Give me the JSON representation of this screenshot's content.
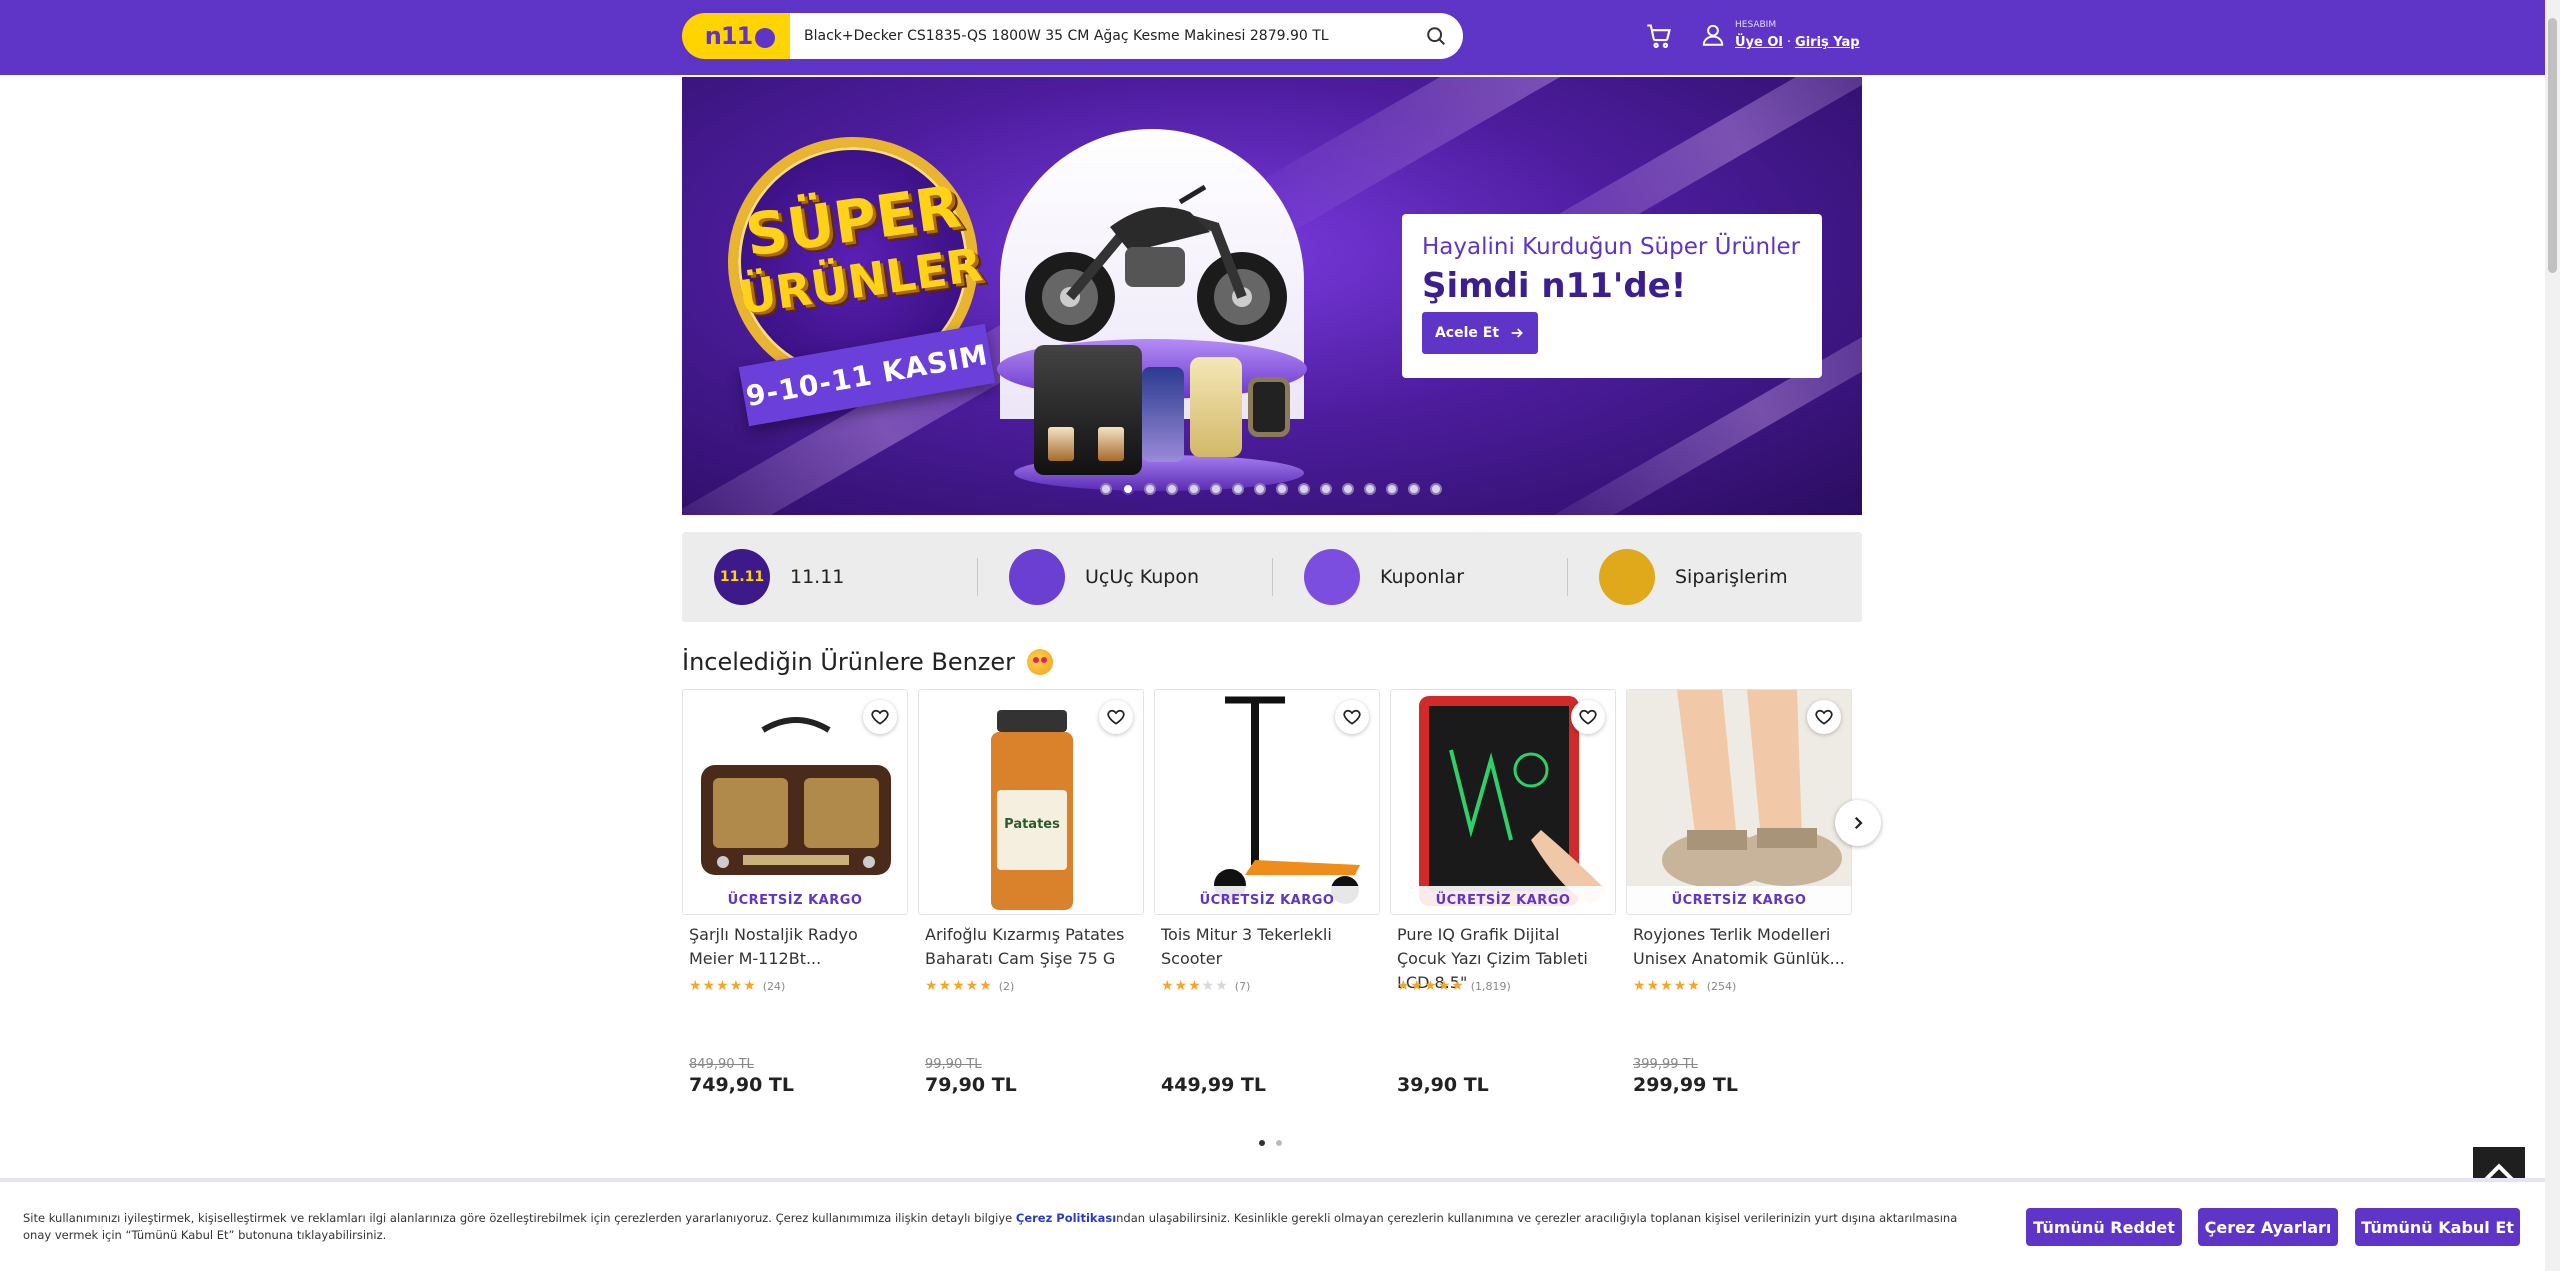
{
  "header": {
    "logo_text": "n11",
    "search_value": "Black+Decker CS1835-QS 1800W 35 CM Ağaç Kesme Makinesi 2879.90 TL",
    "account_label": "HESABIM",
    "signup": "Üye Ol",
    "login": "Giriş Yap",
    "separator": "·",
    "brand_color": "#5f35c8",
    "logo_color": "#ffd400"
  },
  "banner": {
    "badge_line1": "SÜPER",
    "badge_line2": "ÜRÜNLER",
    "date": "9-10-11 KASIM",
    "subtitle": "Hayalini Kurduğun Süper Ürünler",
    "headline": "Şimdi n11'de!",
    "cta": "Acele Et",
    "slide_count": 16,
    "active_slide": 2
  },
  "quick_links": [
    {
      "label": "11.11",
      "icon": "eleven-eleven-icon",
      "badge": "11.11",
      "color": "#3c1a8a"
    },
    {
      "label": "UçUç Kupon",
      "icon": "flying-coupon-icon",
      "badge": "",
      "color": "#6a3fd1"
    },
    {
      "label": "Kuponlar",
      "icon": "coupon-icon",
      "badge": "",
      "color": "#7b4ee0"
    },
    {
      "label": "Siparişlerim",
      "icon": "orders-icon",
      "badge": "",
      "color": "#e0a91b"
    }
  ],
  "section": {
    "title": "İncelediğin Ürünlere Benzer"
  },
  "products": [
    {
      "title": "Şarjlı Nostaljik Radyo Meier M-112Bt...",
      "rating": 4.5,
      "reviews": "(24)",
      "old_price": "849,90 TL",
      "price": "749,90 TL",
      "cargo": "ÜCRETSİZ KARGO",
      "image": "radio"
    },
    {
      "title": "Arifoğlu Kızarmış Patates Baharatı Cam Şişe 75 G",
      "rating": 5,
      "reviews": "(2)",
      "old_price": "99,90 TL",
      "price": "79,90 TL",
      "cargo": "",
      "image": "spice-jar",
      "jar_label": "Patates"
    },
    {
      "title": "Tois Mitur 3 Tekerlekli Scooter",
      "rating": 2.5,
      "reviews": "(7)",
      "old_price": "",
      "price": "449,99 TL",
      "cargo": "ÜCRETSİZ KARGO",
      "image": "scooter"
    },
    {
      "title": "Pure IQ Grafik Dijital Çocuk Yazı Çizim Tableti LCD 8.5\"",
      "rating": 4.5,
      "reviews": "(1,819)",
      "old_price": "",
      "price": "39,90 TL",
      "cargo": "ÜCRETSİZ KARGO",
      "image": "drawing-tablet"
    },
    {
      "title": "Royjones Terlik Modelleri Unisex Anatomik Günlük...",
      "rating": 4.5,
      "reviews": "(254)",
      "old_price": "399,99 TL",
      "price": "299,99 TL",
      "cargo": "ÜCRETSİZ KARGO",
      "image": "slippers"
    }
  ],
  "pager": {
    "pages": 2,
    "active": 1
  },
  "cookie": {
    "text_before": "Site kullanımınızı iyileştirmek, kişiselleştirmek ve reklamları ilgi alanlarınıza göre özelleştirebilmek için çerezlerden yararlanıyoruz. Çerez kullanımımıza ilişkin detaylı bilgiye ",
    "policy_link": "Çerez Politikası",
    "text_after": "ndan ulaşabilirsiniz. Kesinlikle gerekli olmayan çerezlerin kullanımına ve çerezler aracılığıyla toplanan kişisel verilerinizin yurt dışına aktarılmasına onay vermek için “Tümünü Kabul Et” butonuna tıklayabilirsiniz.",
    "reject": "Tümünü Reddet",
    "settings": "Çerez Ayarları",
    "accept": "Tümünü Kabul Et"
  }
}
